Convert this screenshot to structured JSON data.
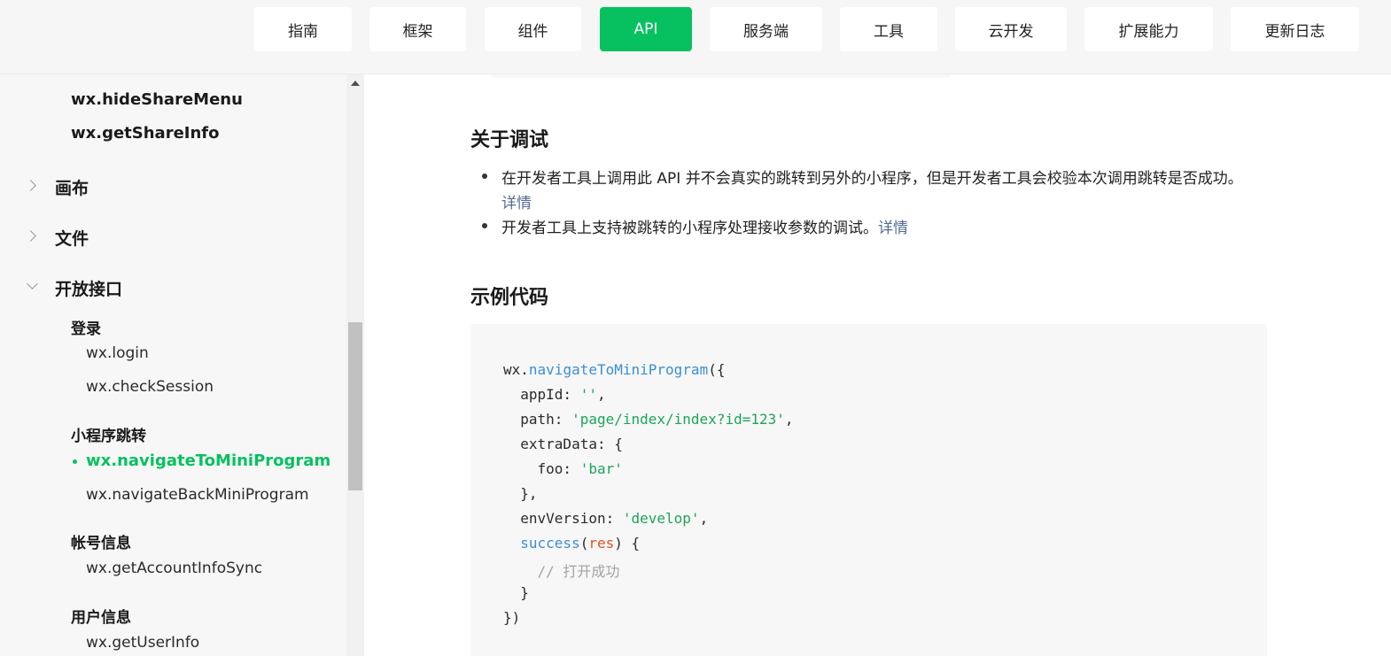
{
  "nav": {
    "items": [
      {
        "label": "指南"
      },
      {
        "label": "框架"
      },
      {
        "label": "组件"
      },
      {
        "label": "API"
      },
      {
        "label": "服务端"
      },
      {
        "label": "工具"
      },
      {
        "label": "云开发"
      },
      {
        "label": "扩展能力"
      },
      {
        "label": "更新日志"
      }
    ],
    "active": "API",
    "accent_color": "#07c160"
  },
  "sidebar": {
    "api_items": [
      "wx.hideShareMenu",
      "wx.getShareInfo"
    ],
    "categories": [
      {
        "label": "画布",
        "state": "collapsed",
        "icon": "chevron-right-icon"
      },
      {
        "label": "文件",
        "state": "collapsed",
        "icon": "chevron-right-icon"
      },
      {
        "label": "开放接口",
        "state": "expanded",
        "icon": "chevron-down-icon"
      }
    ],
    "groups": [
      {
        "label": "登录",
        "links": [
          "wx.login",
          "wx.checkSession"
        ]
      },
      {
        "label": "小程序跳转",
        "links": [
          "wx.navigateToMiniProgram",
          "wx.navigateBackMiniProgram"
        ]
      },
      {
        "label": "帐号信息",
        "links": [
          "wx.getAccountInfoSync"
        ]
      },
      {
        "label": "用户信息",
        "links": [
          "wx.getUserInfo"
        ]
      }
    ],
    "active_link": "wx.navigateToMiniProgram"
  },
  "content": {
    "debug_title": "关于调试",
    "debug_items": [
      {
        "text": "在开发者工具上调用此 API 并不会真实的跳转到另外的小程序，但是开发者工具会校验本次调用跳转是否成功。",
        "link": "详情"
      },
      {
        "text": "开发者工具上支持被跳转的小程序处理接收参数的调试。",
        "link": "详情"
      }
    ],
    "example_title": "示例代码",
    "code": {
      "l1_obj": "wx.",
      "l1_fn": "navigateToMiniProgram",
      "l1_end": "({",
      "l2_key": "  appId: ",
      "l2_val": "''",
      "l2_end": ",",
      "l3_key": "  path: ",
      "l3_val": "'page/index/index?id=123'",
      "l3_end": ",",
      "l4": "  extraData: {",
      "l5_key": "    foo: ",
      "l5_val": "'bar'",
      "l6": "  },",
      "l7_key": "  envVersion: ",
      "l7_val": "'develop'",
      "l7_end": ",",
      "l8_fn": "success",
      "l8_open": "(",
      "l8_param": "res",
      "l8_end": ") {",
      "l9_comment": "    // 打开成功",
      "l10": "  }",
      "l11": "})"
    }
  }
}
